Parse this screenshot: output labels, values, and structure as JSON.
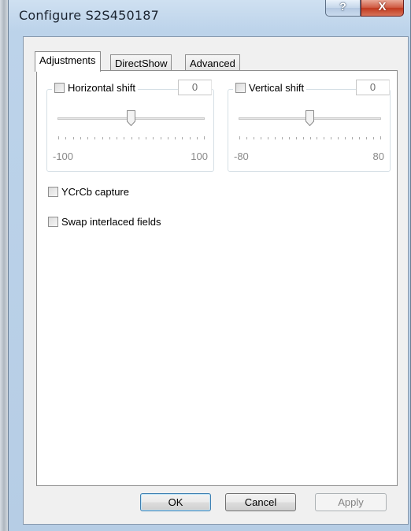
{
  "window": {
    "title": "Configure S2S450187",
    "help_label": "?",
    "close_label": "X"
  },
  "tabs": [
    {
      "label": "Adjustments",
      "active": true
    },
    {
      "label": "DirectShow",
      "active": false
    },
    {
      "label": "Advanced",
      "active": false
    }
  ],
  "adjustments": {
    "horizontal": {
      "label": "Horizontal shift",
      "checked": false,
      "value": "0",
      "min_label": "-100",
      "max_label": "100",
      "position": 0.5
    },
    "vertical": {
      "label": "Vertical shift",
      "checked": false,
      "value": "0",
      "min_label": "-80",
      "max_label": "80",
      "position": 0.5
    },
    "ycrcb": {
      "label": "YCrCb capture",
      "checked": false
    },
    "swap": {
      "label": "Swap interlaced fields",
      "checked": false
    }
  },
  "buttons": {
    "ok": "OK",
    "cancel": "Cancel",
    "apply": "Apply"
  },
  "colors": {
    "close": "#c13a1f",
    "frame": "#b6cde5",
    "default_button_border": "#3c7fb1"
  }
}
